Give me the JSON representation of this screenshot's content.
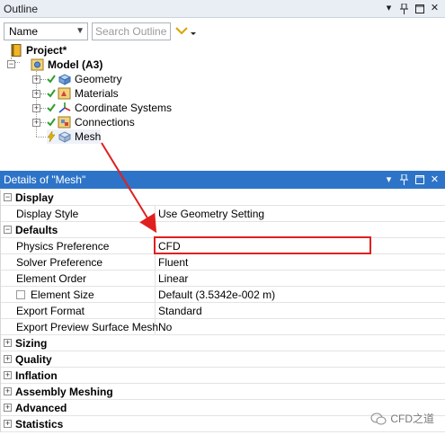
{
  "outline": {
    "title": "Outline",
    "sort_label": "Name",
    "search_placeholder": "Search Outline",
    "tree": {
      "project": "Project*",
      "model": "Model (A3)",
      "children": [
        "Geometry",
        "Materials",
        "Coordinate Systems",
        "Connections",
        "Mesh"
      ]
    }
  },
  "details": {
    "title": "Details of \"Mesh\"",
    "groups": {
      "display": "Display",
      "defaults": "Defaults",
      "sizing": "Sizing",
      "quality": "Quality",
      "inflation": "Inflation",
      "assembly": "Assembly Meshing",
      "advanced": "Advanced",
      "statistics": "Statistics"
    },
    "rows": {
      "display_style": {
        "prop": "Display Style",
        "value": "Use Geometry Setting"
      },
      "physics": {
        "prop": "Physics Preference",
        "value": "CFD"
      },
      "solver": {
        "prop": "Solver Preference",
        "value": "Fluent"
      },
      "order": {
        "prop": "Element Order",
        "value": "Linear"
      },
      "size": {
        "prop": "Element Size",
        "value": "Default (3.5342e-002 m)"
      },
      "export_format": {
        "prop": "Export Format",
        "value": "Standard"
      },
      "export_preview": {
        "prop": "Export Preview Surface Mesh",
        "value": "No"
      }
    }
  },
  "watermark": "CFD之道",
  "colors": {
    "highlight": "#e02020",
    "title_bar": "#2d74c8",
    "check": "#2f9e2f"
  }
}
